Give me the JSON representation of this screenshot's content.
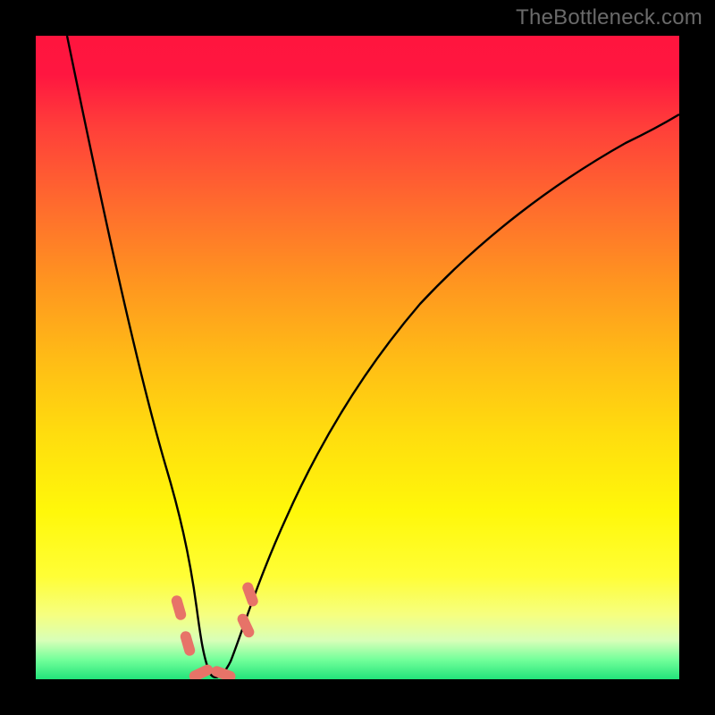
{
  "watermark": "TheBottleneck.com",
  "colors": {
    "black": "#000000",
    "gradient_top": "#ff153e",
    "gradient_mid": "#ffdd0e",
    "gradient_bottom": "#22e47a",
    "curve": "#000000",
    "marker": "#e77368",
    "watermark": "#6a6a6a"
  },
  "chart_data": {
    "type": "line",
    "title": "",
    "xlabel": "",
    "ylabel": "",
    "xlim": [
      0,
      100
    ],
    "ylim": [
      0,
      100
    ],
    "note": "No axes or ticks rendered; values estimated from pixel positions in a 720×720 plot area, mapped to 0–100.",
    "series": [
      {
        "name": "curve",
        "x": [
          4.9,
          8.3,
          11.8,
          14.6,
          17.4,
          19.4,
          21.5,
          23.6,
          25.0,
          26.4,
          27.8,
          29.2,
          30.6,
          33.3,
          36.1,
          38.9,
          43.1,
          47.2,
          52.8,
          58.3,
          65.3,
          72.2,
          80.6,
          88.9,
          97.2,
          100.0
        ],
        "y": [
          100.0,
          80.6,
          61.1,
          47.2,
          33.3,
          23.6,
          13.9,
          5.6,
          2.1,
          0.7,
          0.7,
          2.1,
          4.9,
          12.5,
          22.2,
          30.6,
          41.7,
          50.0,
          58.3,
          64.6,
          70.8,
          75.7,
          80.6,
          84.0,
          86.8,
          87.8
        ]
      }
    ],
    "markers": [
      {
        "shape": "capsule",
        "x": 22.2,
        "y": 11.1,
        "angle": -75
      },
      {
        "shape": "capsule",
        "x": 23.6,
        "y": 5.6,
        "angle": -75
      },
      {
        "shape": "capsule",
        "x": 25.7,
        "y": 1.0,
        "angle": -25
      },
      {
        "shape": "capsule",
        "x": 29.2,
        "y": 0.8,
        "angle": 20
      },
      {
        "shape": "capsule",
        "x": 32.6,
        "y": 8.3,
        "angle": 65
      },
      {
        "shape": "capsule",
        "x": 33.3,
        "y": 13.2,
        "angle": 70
      }
    ]
  }
}
